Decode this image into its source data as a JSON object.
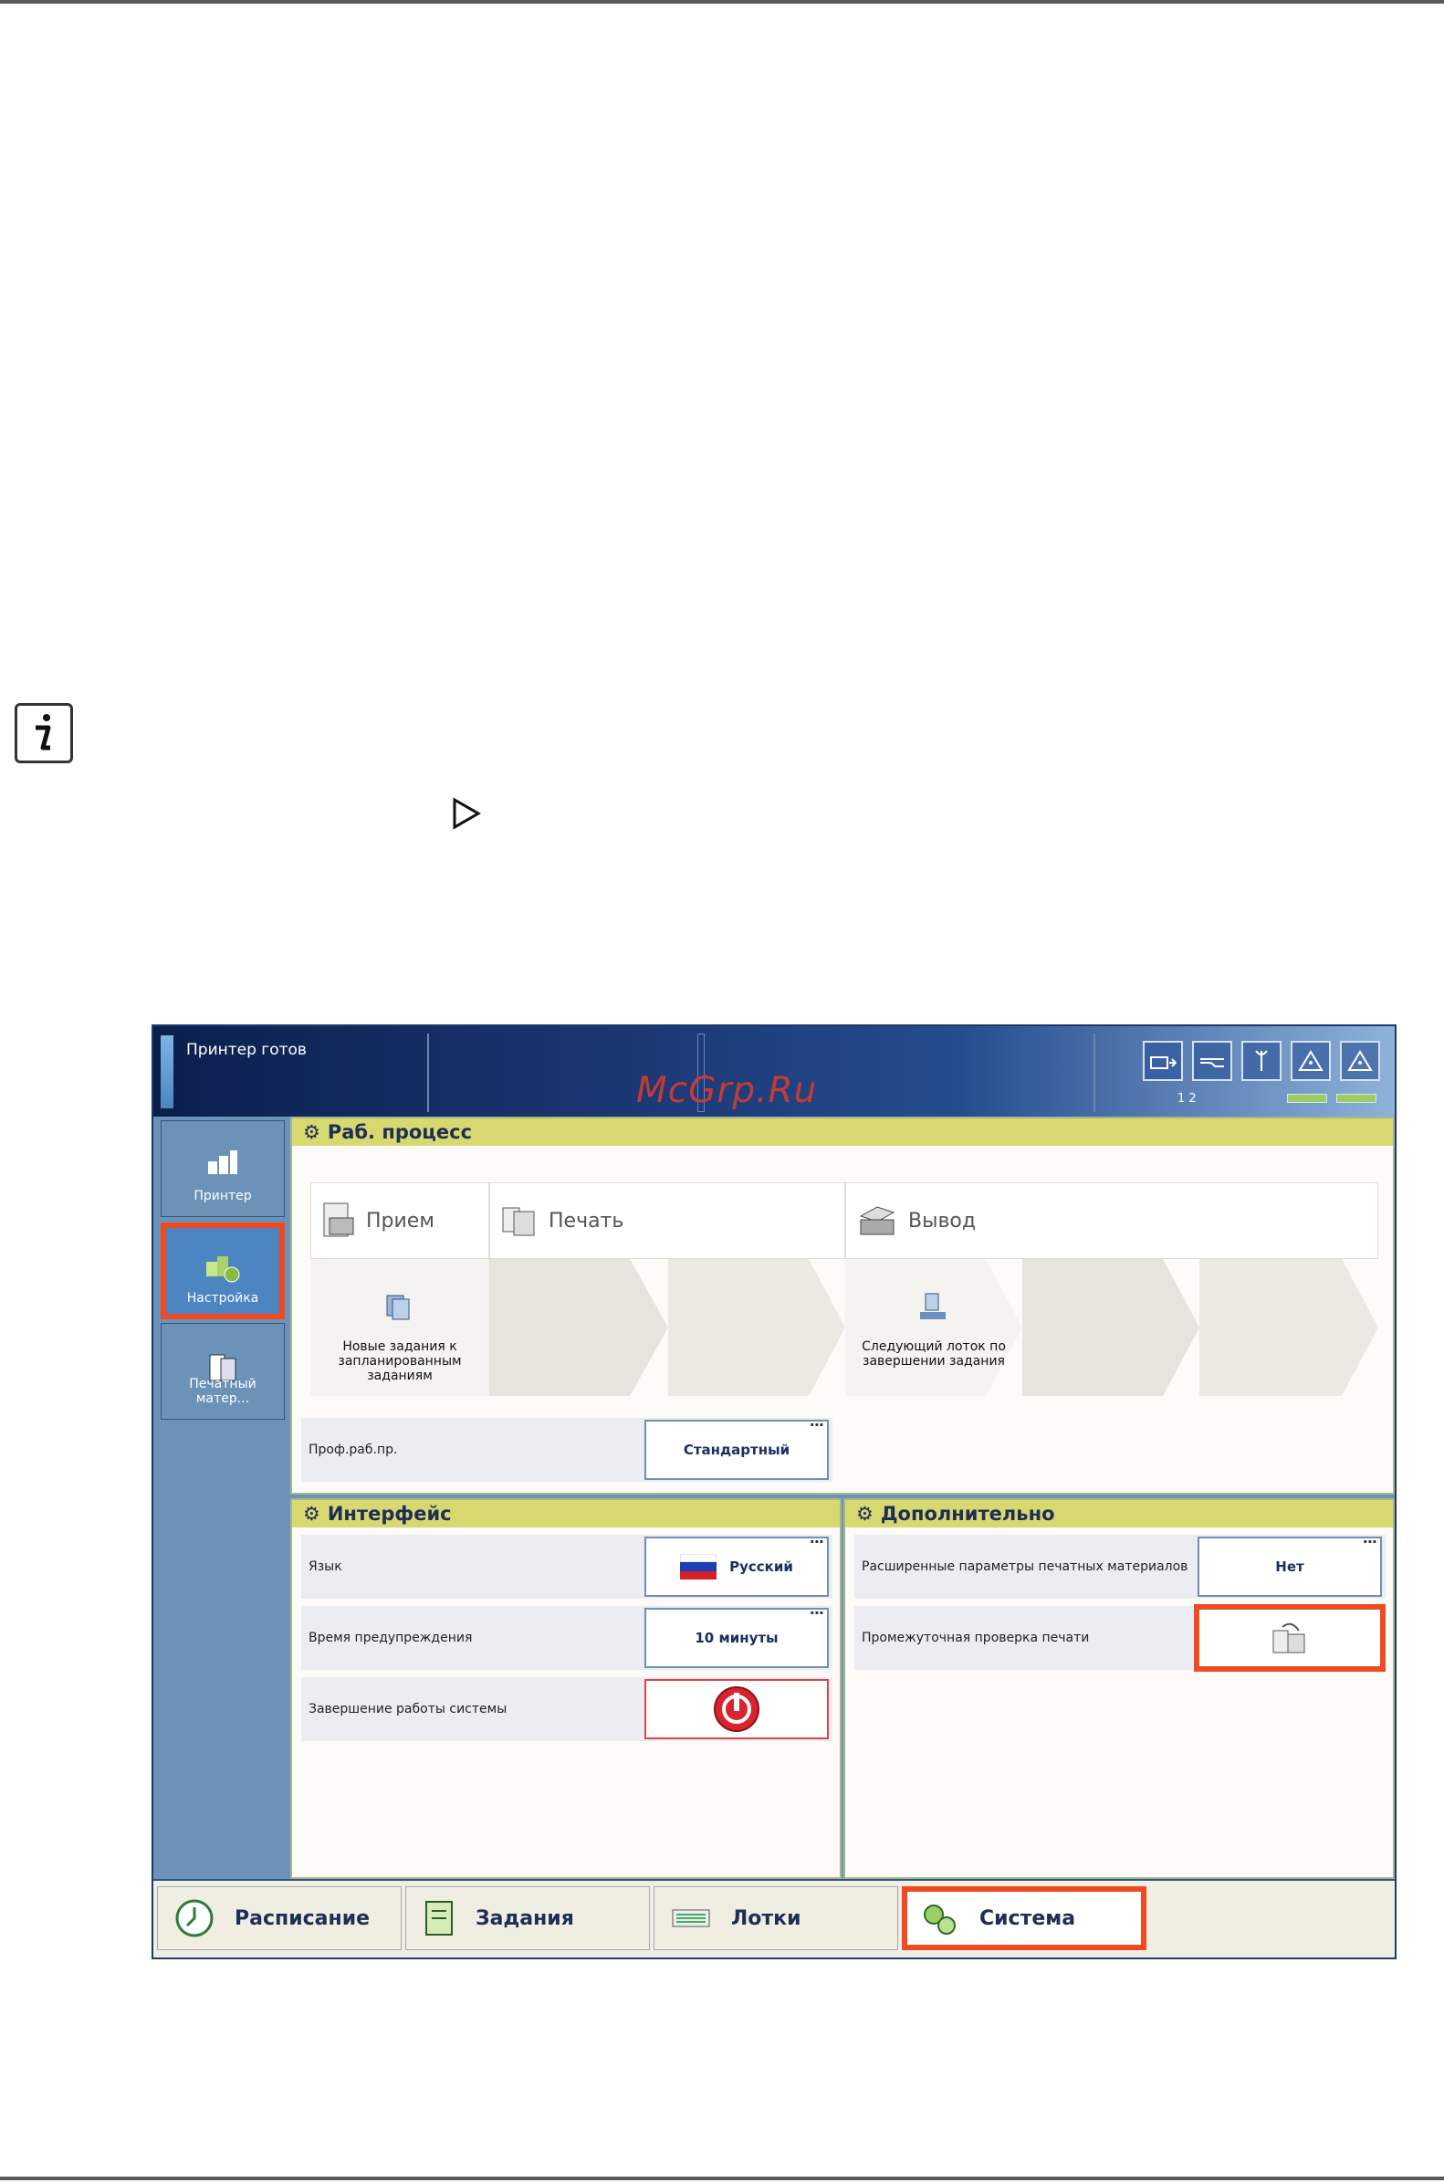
{
  "header": {
    "status": "Принтер готов",
    "tray_numbers": "1  2"
  },
  "watermark": "McGrp.Ru",
  "sidebar": {
    "items": [
      {
        "label": "Принтер",
        "icon": "printer-icon"
      },
      {
        "label": "Настройка",
        "icon": "settings-icon",
        "active": true
      },
      {
        "label": "Печатный матер...",
        "icon": "media-icon"
      }
    ]
  },
  "workflow": {
    "title": "Раб. процесс",
    "stages": [
      {
        "label": "Прием",
        "icon": "receive-icon"
      },
      {
        "label": "Печать",
        "icon": "print-icon"
      },
      {
        "label": "Вывод",
        "icon": "output-icon"
      }
    ],
    "tiles": {
      "receive": "Новые задания к запланированным заданиям",
      "output": "Следующий лоток по завершении задания"
    },
    "profile_label": "Проф.раб.пр.",
    "profile_value": "Стандартный"
  },
  "interface": {
    "title": "Интерфейс",
    "language_label": "Язык",
    "language_value": "Русский",
    "warning_label": "Время предупреждения",
    "warning_value": "10 минуты",
    "shutdown_label": "Завершение работы системы"
  },
  "additional": {
    "title": "Дополнительно",
    "media_label": "Расширенные параметры печатных материалов",
    "media_value": "Нет",
    "check_label": "Промежуточная проверка печати"
  },
  "tabs": [
    {
      "label": "Расписание",
      "icon": "clock-icon"
    },
    {
      "label": "Задания",
      "icon": "jobs-icon"
    },
    {
      "label": "Лотки",
      "icon": "trays-icon"
    },
    {
      "label": "Система",
      "icon": "gears-icon",
      "selected": true
    }
  ],
  "colors": {
    "highlight": "#ef4a20",
    "panel_title": "#d8d870",
    "sidebar": "#6b93b8"
  }
}
